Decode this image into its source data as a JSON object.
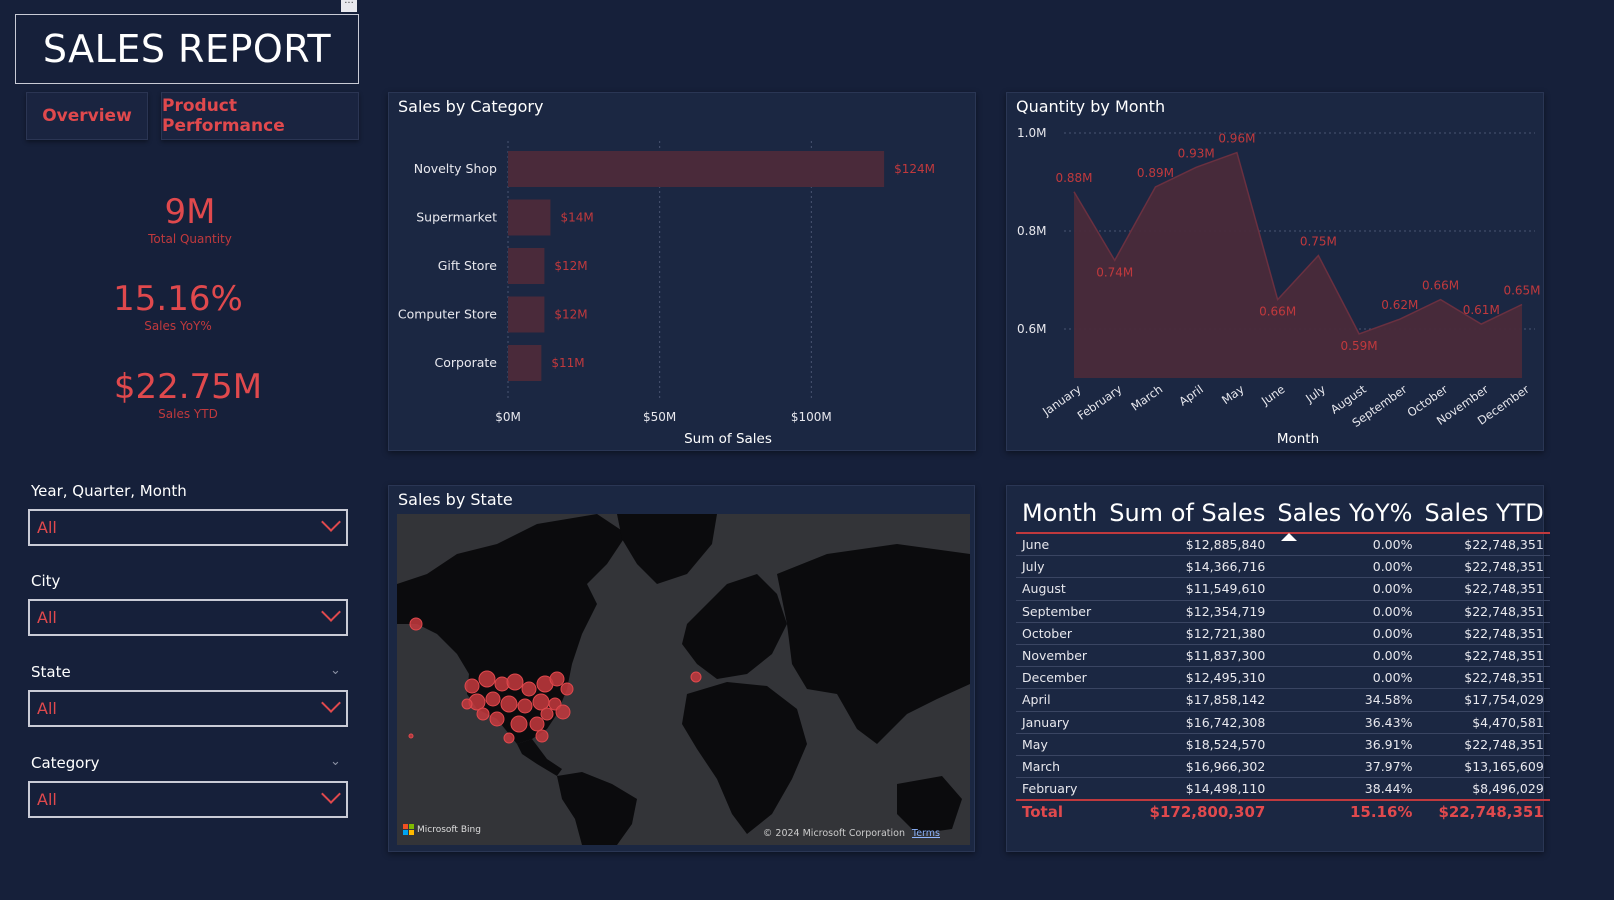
{
  "title": "SALES REPORT",
  "title_menu_icon": "more-options-icon",
  "nav": {
    "overview": "Overview",
    "product_performance": "Product Performance"
  },
  "kpis": [
    {
      "value": "9M",
      "label": "Total Quantity"
    },
    {
      "value": "15.16%",
      "label": "Sales YoY%"
    },
    {
      "value": "$22.75M",
      "label": "Sales YTD"
    }
  ],
  "slicers": [
    {
      "label": "Year, Quarter, Month",
      "value": "All"
    },
    {
      "label": "City",
      "value": "All"
    },
    {
      "label": "State",
      "value": "All"
    },
    {
      "label": "Category",
      "value": "All"
    }
  ],
  "sales_by_category": {
    "title": "Sales by Category",
    "xlabel": "Sum of Sales",
    "ticks": [
      "$0M",
      "$50M",
      "$100M"
    ]
  },
  "quantity_by_month": {
    "title": "Quantity by Month",
    "xlabel": "Month",
    "y_ticks": [
      "1.0M",
      "0.8M",
      "0.6M"
    ]
  },
  "sales_by_state": {
    "title": "Sales by State",
    "bing_label": "Microsoft Bing",
    "copyright": "© 2024 Microsoft Corporation",
    "terms": "Terms"
  },
  "table": {
    "headers": [
      "Month",
      "Sum of Sales",
      "Sales YoY%",
      "Sales YTD"
    ],
    "rows": [
      [
        "June",
        "$12,885,840",
        "0.00%",
        "$22,748,351"
      ],
      [
        "July",
        "$14,366,716",
        "0.00%",
        "$22,748,351"
      ],
      [
        "August",
        "$11,549,610",
        "0.00%",
        "$22,748,351"
      ],
      [
        "September",
        "$12,354,719",
        "0.00%",
        "$22,748,351"
      ],
      [
        "October",
        "$12,721,380",
        "0.00%",
        "$22,748,351"
      ],
      [
        "November",
        "$11,837,300",
        "0.00%",
        "$22,748,351"
      ],
      [
        "December",
        "$12,495,310",
        "0.00%",
        "$22,748,351"
      ],
      [
        "April",
        "$17,858,142",
        "34.58%",
        "$17,754,029"
      ],
      [
        "January",
        "$16,742,308",
        "36.43%",
        "$4,470,581"
      ],
      [
        "May",
        "$18,524,570",
        "36.91%",
        "$22,748,351"
      ],
      [
        "March",
        "$16,966,302",
        "37.97%",
        "$13,165,609"
      ],
      [
        "February",
        "$14,498,110",
        "38.44%",
        "$8,496,029"
      ]
    ],
    "total": [
      "Total",
      "$172,800,307",
      "15.16%",
      "$22,748,351"
    ]
  },
  "colors": {
    "background": "#16203a",
    "accent": "#e0494d",
    "bar_fill": "#4a2a3a",
    "area_fill": "#4a2a3a",
    "area_line": "#6a3040"
  },
  "chart_data": [
    {
      "type": "bar",
      "orientation": "horizontal",
      "title": "Sales by Category",
      "xlabel": "Sum of Sales",
      "categories": [
        "Novelty Shop",
        "Supermarket",
        "Gift Store",
        "Computer Store",
        "Corporate"
      ],
      "values": [
        124,
        14,
        12,
        12,
        11
      ],
      "data_labels": [
        "$124M",
        "$14M",
        "$12M",
        "$12M",
        "$11M"
      ],
      "unit": "$M",
      "xlim": [
        0,
        150
      ],
      "x_ticks": [
        0,
        50,
        100
      ],
      "grid": true
    },
    {
      "type": "area",
      "title": "Quantity by Month",
      "xlabel": "Month",
      "categories": [
        "January",
        "February",
        "March",
        "April",
        "May",
        "June",
        "July",
        "August",
        "September",
        "October",
        "November",
        "December"
      ],
      "values": [
        0.88,
        0.74,
        0.89,
        0.93,
        0.96,
        0.66,
        0.75,
        0.59,
        0.62,
        0.66,
        0.61,
        0.65
      ],
      "data_labels": [
        "0.88M",
        "0.74M",
        "0.89M",
        "0.93M",
        "0.96M",
        "0.66M",
        "0.75M",
        "0.59M",
        "0.62M",
        "0.66M",
        "0.61M",
        "0.65M"
      ],
      "unit": "M",
      "ylim": [
        0.5,
        1.0
      ],
      "y_ticks": [
        0.6,
        0.8,
        1.0
      ],
      "grid": true
    }
  ]
}
